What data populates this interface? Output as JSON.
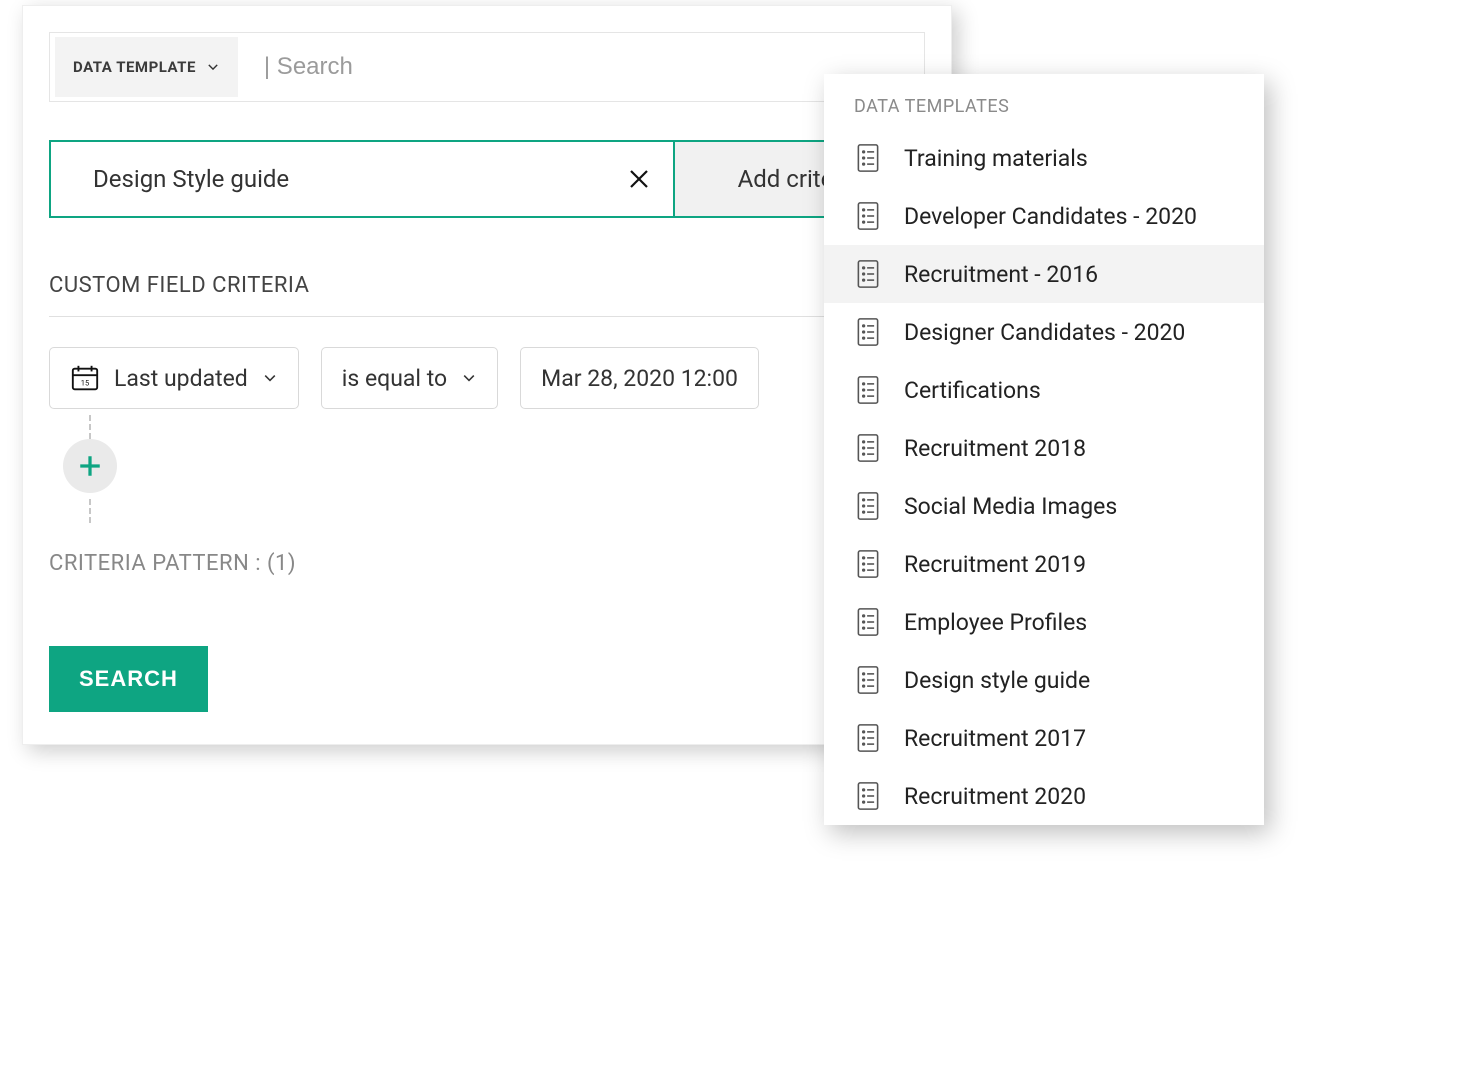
{
  "searchbar": {
    "type_label": "DATA TEMPLATE",
    "placeholder": "| Search"
  },
  "criteria": {
    "value": "Design Style guide",
    "add_label": "Add criteria"
  },
  "custom_fields": {
    "title": "CUSTOM FIELD CRITERIA",
    "field": "Last updated",
    "operator": "is equal to",
    "value": "Mar 28, 2020 12:00",
    "pattern_label": "CRITERIA PATTERN :",
    "pattern_value": "(1)"
  },
  "actions": {
    "search": "SEARCH"
  },
  "popover": {
    "header": "DATA TEMPLATES",
    "highlighted_index": 2,
    "items": [
      "Training materials",
      "Developer Candidates - 2020",
      "Recruitment - 2016",
      "Designer Candidates - 2020",
      "Certifications",
      "Recruitment 2018",
      "Social Media Images",
      "Recruitment 2019",
      "Employee Profiles",
      "Design style guide",
      "Recruitment 2017",
      "Recruitment 2020"
    ]
  }
}
